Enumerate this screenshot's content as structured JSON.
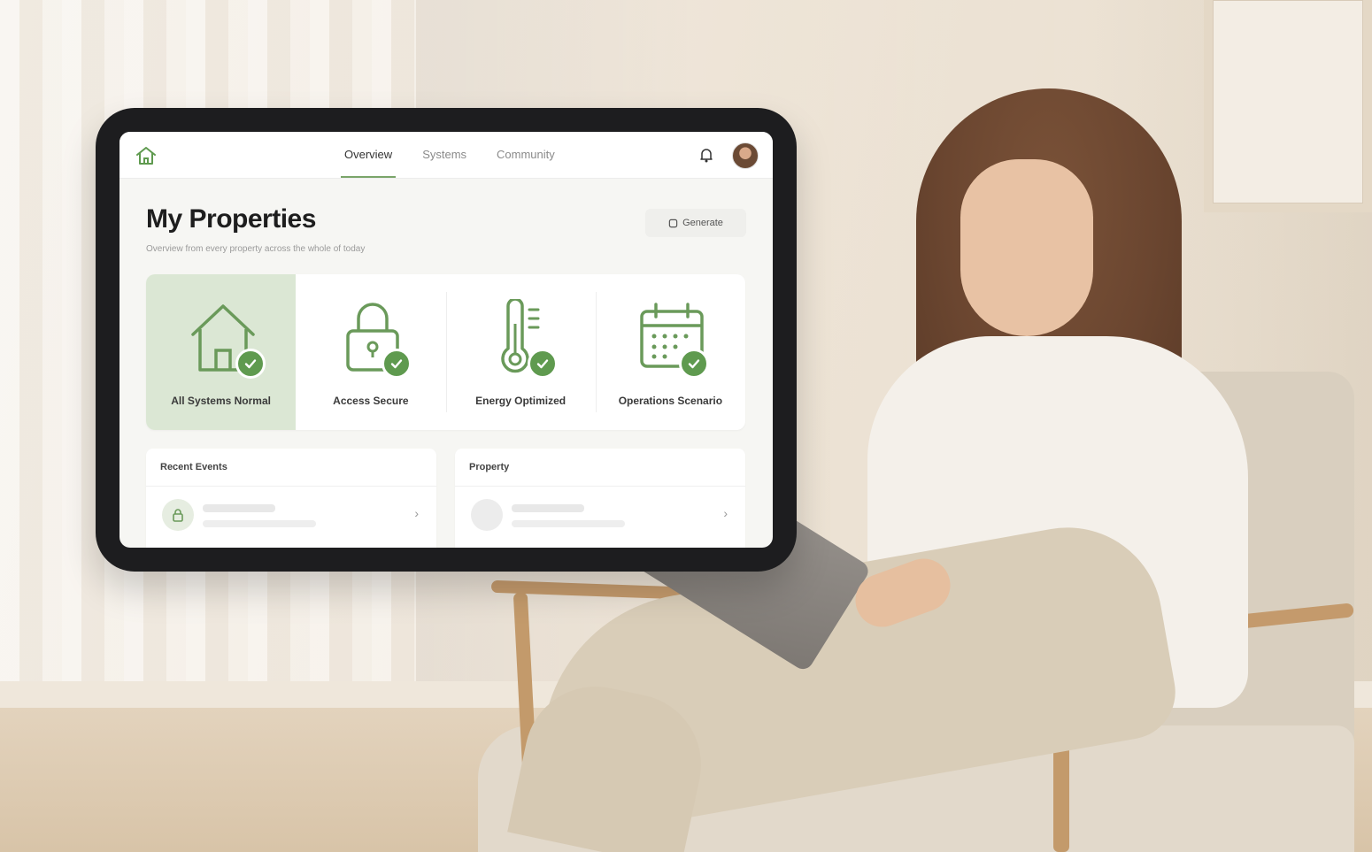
{
  "app": {
    "nav_tabs": [
      {
        "label": "Overview",
        "active": true
      },
      {
        "label": "Systems",
        "active": false
      },
      {
        "label": "Community",
        "active": false
      }
    ],
    "icons": {
      "home": "home-icon",
      "notifications": "bell-icon",
      "profile": "avatar"
    }
  },
  "page": {
    "title": "My Properties",
    "subtitle": "Overview from every property across the whole of today",
    "action_label": "Generate"
  },
  "status_cards": [
    {
      "label": "All Systems Normal",
      "icon": "house-icon",
      "active": true
    },
    {
      "label": "Access Secure",
      "icon": "padlock-icon",
      "active": false
    },
    {
      "label": "Energy Optimized",
      "icon": "thermometer-icon",
      "active": false
    },
    {
      "label": "Operations Scenario",
      "icon": "calendar-icon",
      "active": false
    }
  ],
  "lists": {
    "left": {
      "title": "Recent Events"
    },
    "right": {
      "title": "Property"
    }
  },
  "colors": {
    "accent_green": "#5f9a4f",
    "active_card_bg": "#dbe7d4",
    "icon_stroke": "#6a9a5a"
  }
}
